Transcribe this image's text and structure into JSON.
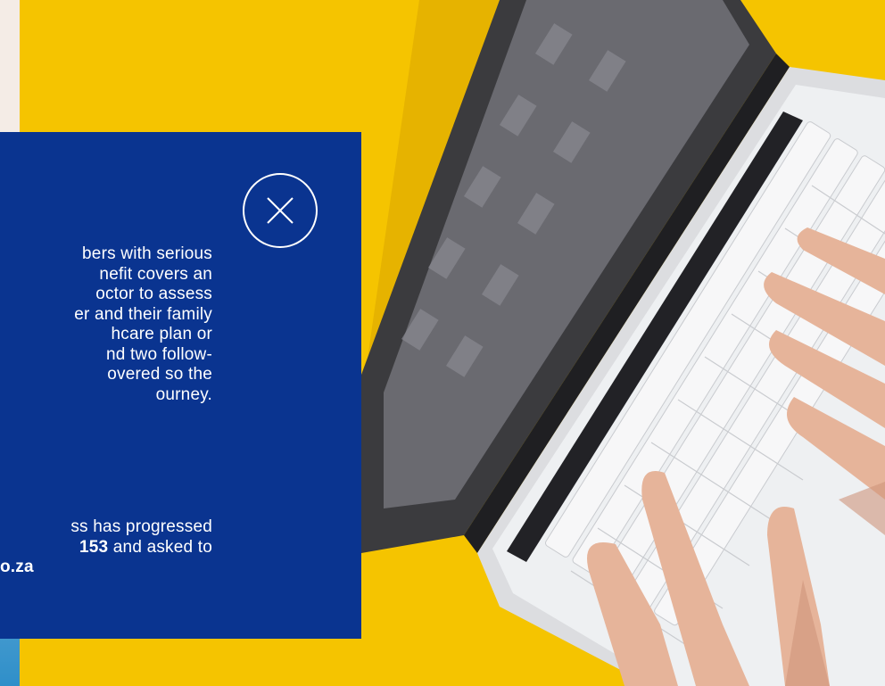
{
  "modal": {
    "close_icon": "close-x-icon",
    "paragraph_1_lines": [
      "bers with serious",
      "nefit covers an",
      "octor to assess",
      "er and their family",
      "hcare plan or",
      "nd two follow-",
      "overed so the",
      "ourney."
    ],
    "paragraph_2": {
      "line_1": "ss has progressed",
      "line_2_prefix": "",
      "line_2_bold": "153",
      "line_2_suffix": " and asked to",
      "line_3_bold": "o.za"
    }
  },
  "colors": {
    "background_yellow": "#f5c400",
    "modal_blue": "#0a3490",
    "text": "#ffffff"
  },
  "image": {
    "subject": "hands typing on laptop"
  }
}
